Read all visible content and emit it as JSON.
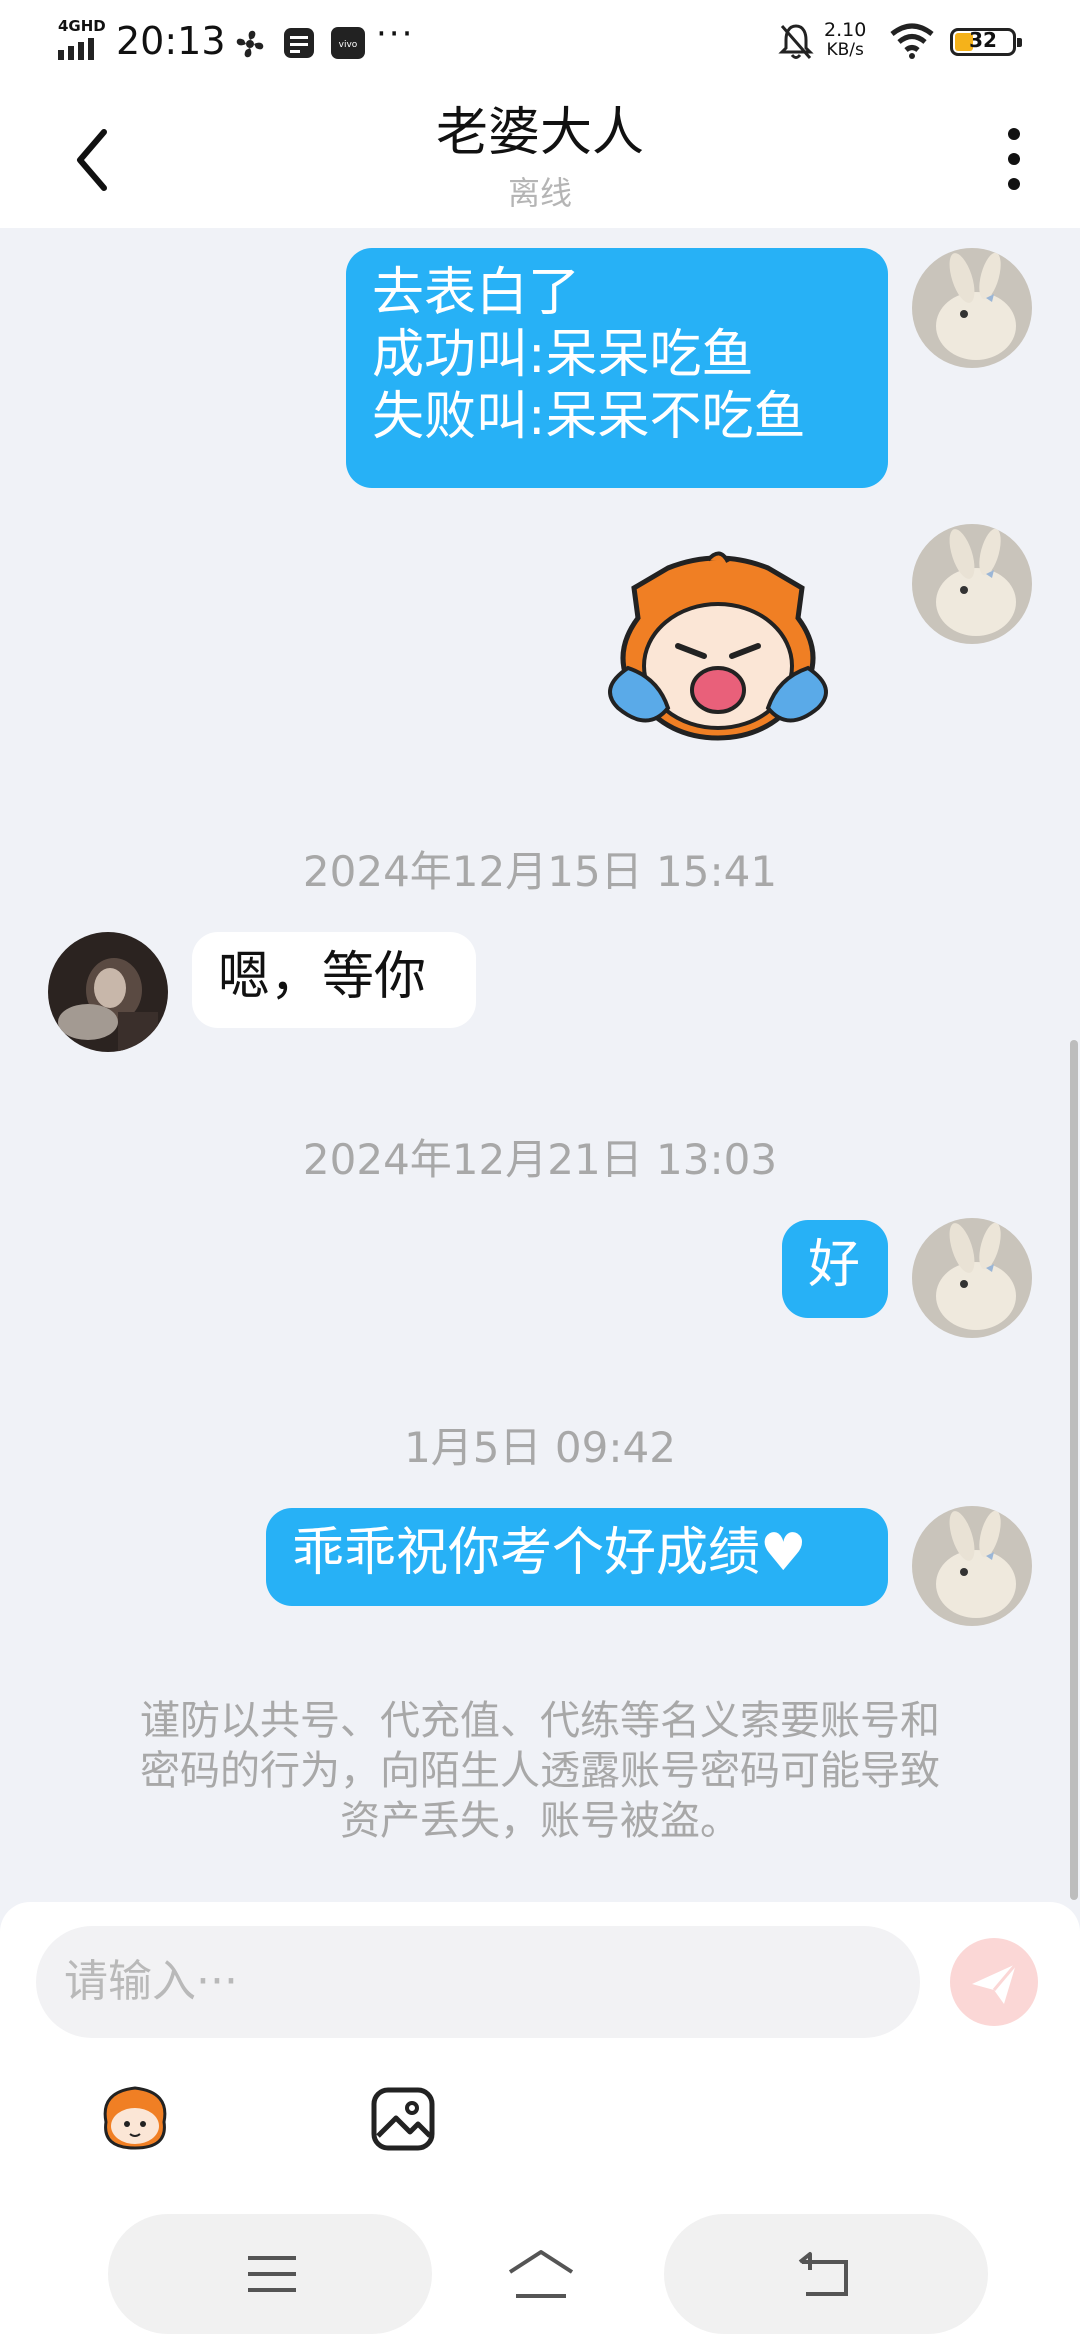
{
  "status_bar": {
    "network": "4GHD",
    "time": "20:13",
    "speed_value": "2.10",
    "speed_unit": "KB/s",
    "battery": "32",
    "more": "···"
  },
  "header": {
    "title": "老婆大人",
    "status": "离线"
  },
  "messages": {
    "m1_lines": [
      "去表白了",
      "成功叫:呆呆吃鱼",
      "失败叫:呆呆不吃鱼"
    ],
    "ts1": "2024年12月15日 15:41",
    "m3": "嗯，等你",
    "ts2": "2024年12月21日 13:03",
    "m4": "好",
    "ts3": "1月5日 09:42",
    "m5": "乖乖祝你考个好成绩♥"
  },
  "notice_lines": [
    "谨防以共号、代充值、代练等名义索要账号和",
    "密码的行为，向陌生人透露账号密码可能导致",
    "资产丢失，账号被盗。"
  ],
  "input": {
    "placeholder": "请输入···"
  },
  "icons": [
    "back-icon",
    "more-options-icon",
    "send-icon",
    "sticker-icon",
    "image-icon",
    "nav-menu-icon",
    "nav-home-icon",
    "nav-back-icon"
  ],
  "colors": {
    "outgoing_bubble": "#27b1f6",
    "incoming_bubble": "#ffffff",
    "background": "#f0f2f7",
    "send_button": "#fbd7d6"
  }
}
